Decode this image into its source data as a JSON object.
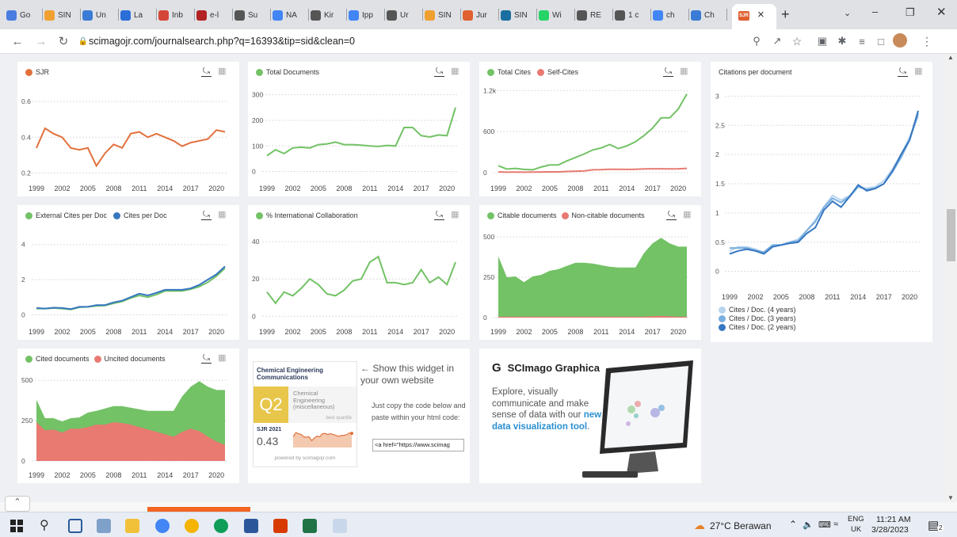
{
  "browser": {
    "tabs": [
      {
        "label": "Go",
        "color": "#4a7de0"
      },
      {
        "label": "SIN",
        "color": "#f0a030"
      },
      {
        "label": "Un",
        "color": "#3a7bd5"
      },
      {
        "label": "La",
        "color": "#2c6ed8"
      },
      {
        "label": "Inb",
        "color": "#d44638"
      },
      {
        "label": "e-l",
        "color": "#b22222"
      },
      {
        "label": "Su",
        "color": "#555"
      },
      {
        "label": "NA",
        "color": "#4285f4"
      },
      {
        "label": "Kir",
        "color": "#555"
      },
      {
        "label": "Ipp",
        "color": "#4285f4"
      },
      {
        "label": "Ur",
        "color": "#555"
      },
      {
        "label": "SIN",
        "color": "#f0a030"
      },
      {
        "label": "Jur",
        "color": "#e06030"
      },
      {
        "label": "SIN",
        "color": "#1a6fa0"
      },
      {
        "label": "Wi",
        "color": "#25d366"
      },
      {
        "label": "RE",
        "color": "#555"
      },
      {
        "label": "1 c",
        "color": "#555"
      },
      {
        "label": "ch",
        "color": "#4285f4"
      },
      {
        "label": "Ch",
        "color": "#3a7bd5"
      }
    ],
    "active_tab_favicon": "SJR",
    "active_close": "×",
    "new_tab": "+",
    "url": "scimagojr.com/journalsearch.php?q=16393&tip=sid&clean=0",
    "nav_icons": [
      "back-icon",
      "forward-icon",
      "reload-icon",
      "lock-icon"
    ]
  },
  "charts": {
    "sjr": {
      "legend": "SJR",
      "color": "#e2713c"
    },
    "total_docs": {
      "legend": "Total Documents",
      "color": "#73c266"
    },
    "total_cites": {
      "legend": "Total Cites",
      "legend2": "Self-Cites",
      "color": "#73c266",
      "color2": "#e87a72"
    },
    "cit_per_doc": {
      "title": "Citations per document",
      "legend": [
        "Cites / Doc. (4 years)",
        "Cites / Doc. (3 years)",
        "Cites / Doc. (2 years)"
      ]
    },
    "ext_cites": {
      "legend": "External Cites per Doc",
      "legend2": "Cites per Doc"
    },
    "intl": {
      "legend": "% International Collaboration"
    },
    "citable": {
      "legend": "Citable documents",
      "legend2": "Non-citable documents"
    },
    "cited": {
      "legend": "Cited documents",
      "legend2": "Uncited documents"
    }
  },
  "widget": {
    "title": "Chemical Engineering Communications",
    "quartile": "Q2",
    "category": "Chemical Engineering (miscellaneous)",
    "best": "best quartile",
    "sjr_label": "SJR 2021",
    "sjr_value": "0.43",
    "powered": "powered by scimagojr.com",
    "show_text": "← Show this widget in your own website",
    "copy_text": "Just copy the code below and paste within your html code:",
    "code": "<a href=\"https://www.scimag"
  },
  "graphica": {
    "title": "SCImago Graphica",
    "text": "Explore, visually communicate and make sense of data with our",
    "link": "new data visualization tool",
    "period": "."
  },
  "taskbar": {
    "weather": "27°C  Berawan",
    "lang": "ENG",
    "region": "UK",
    "time": "11:21 AM",
    "date": "3/28/2023",
    "notif": "2"
  },
  "chart_data": [
    {
      "id": "sjr",
      "type": "line",
      "x": [
        1999,
        2000,
        2001,
        2002,
        2003,
        2004,
        2005,
        2006,
        2007,
        2008,
        2009,
        2010,
        2011,
        2012,
        2013,
        2014,
        2015,
        2016,
        2017,
        2018,
        2019,
        2020,
        2021
      ],
      "series": [
        {
          "name": "SJR",
          "values": [
            0.34,
            0.45,
            0.42,
            0.4,
            0.34,
            0.33,
            0.34,
            0.24,
            0.31,
            0.36,
            0.34,
            0.42,
            0.43,
            0.4,
            0.42,
            0.4,
            0.38,
            0.35,
            0.37,
            0.38,
            0.39,
            0.44,
            0.43
          ]
        }
      ],
      "ylim": [
        0.18,
        0.68
      ],
      "yticks": [
        0.2,
        0.4,
        0.6
      ],
      "xticks": [
        1999,
        2002,
        2005,
        2008,
        2011,
        2014,
        2017,
        2020
      ]
    },
    {
      "id": "docs",
      "type": "line",
      "x": [
        1999,
        2000,
        2001,
        2002,
        2003,
        2004,
        2005,
        2006,
        2007,
        2008,
        2009,
        2010,
        2011,
        2012,
        2013,
        2014,
        2015,
        2016,
        2017,
        2018,
        2019,
        2020,
        2021
      ],
      "series": [
        {
          "name": "Total Documents",
          "values": [
            62,
            85,
            70,
            92,
            95,
            92,
            105,
            108,
            115,
            105,
            105,
            103,
            100,
            98,
            102,
            100,
            172,
            172,
            140,
            135,
            143,
            140,
            250
          ]
        }
      ],
      "ylim": [
        -20,
        330
      ],
      "yticks": [
        0,
        100,
        200,
        300
      ],
      "xticks": [
        1999,
        2002,
        2005,
        2008,
        2011,
        2014,
        2017,
        2020
      ]
    },
    {
      "id": "cites",
      "type": "line",
      "x": [
        1999,
        2000,
        2001,
        2002,
        2003,
        2004,
        2005,
        2006,
        2007,
        2008,
        2009,
        2010,
        2011,
        2012,
        2013,
        2014,
        2015,
        2016,
        2017,
        2018,
        2019,
        2020,
        2021
      ],
      "series": [
        {
          "name": "Total Cites",
          "values": [
            100,
            50,
            60,
            45,
            40,
            80,
            110,
            110,
            170,
            220,
            270,
            330,
            360,
            410,
            350,
            390,
            450,
            540,
            650,
            800,
            800,
            930,
            1150
          ]
        },
        {
          "name": "Self-Cites",
          "values": [
            10,
            5,
            6,
            5,
            6,
            8,
            10,
            10,
            15,
            20,
            22,
            40,
            42,
            48,
            48,
            45,
            48,
            52,
            55,
            55,
            52,
            55,
            60
          ]
        }
      ],
      "ylim": [
        -60,
        1250
      ],
      "yticks": [
        0,
        600,
        1200
      ],
      "yticklabels": [
        "0",
        "600",
        "1.2k"
      ],
      "xticks": [
        1999,
        2002,
        2005,
        2008,
        2011,
        2014,
        2017,
        2020
      ]
    },
    {
      "id": "cpd",
      "type": "line",
      "x": [
        1999,
        2000,
        2001,
        2002,
        2003,
        2004,
        2005,
        2006,
        2007,
        2008,
        2009,
        2010,
        2011,
        2012,
        2013,
        2014,
        2015,
        2016,
        2017,
        2018,
        2019,
        2020,
        2021
      ],
      "series": [
        {
          "name": "Cites / Doc. (4 years)",
          "values": [
            0.35,
            0.42,
            0.42,
            0.38,
            0.32,
            0.45,
            0.45,
            0.5,
            0.55,
            0.7,
            0.88,
            1.1,
            1.3,
            1.22,
            1.3,
            1.45,
            1.42,
            1.45,
            1.55,
            1.75,
            2.0,
            2.3,
            2.65
          ]
        },
        {
          "name": "Cites / Doc. (3 years)",
          "values": [
            0.4,
            0.4,
            0.4,
            0.36,
            0.33,
            0.45,
            0.45,
            0.5,
            0.52,
            0.7,
            0.85,
            1.1,
            1.25,
            1.18,
            1.28,
            1.45,
            1.4,
            1.42,
            1.5,
            1.7,
            1.95,
            2.25,
            2.7
          ]
        },
        {
          "name": "Cites / Doc. (2 years)",
          "values": [
            0.3,
            0.35,
            0.38,
            0.35,
            0.3,
            0.42,
            0.45,
            0.48,
            0.5,
            0.65,
            0.75,
            1.05,
            1.2,
            1.1,
            1.28,
            1.48,
            1.38,
            1.42,
            1.5,
            1.72,
            2.0,
            2.25,
            2.75
          ]
        }
      ],
      "ylim": [
        -0.1,
        3.1
      ],
      "yticks": [
        0,
        0.5,
        1,
        1.5,
        2,
        2.5,
        3
      ],
      "xticks": [
        1999,
        2002,
        2005,
        2008,
        2011,
        2014,
        2017,
        2020
      ]
    },
    {
      "id": "ext",
      "type": "line",
      "x": [
        1999,
        2000,
        2001,
        2002,
        2003,
        2004,
        2005,
        2006,
        2007,
        2008,
        2009,
        2010,
        2011,
        2012,
        2013,
        2014,
        2015,
        2016,
        2017,
        2018,
        2019,
        2020,
        2021
      ],
      "series": [
        {
          "name": "External Cites per Doc",
          "values": [
            0.35,
            0.35,
            0.38,
            0.35,
            0.3,
            0.42,
            0.45,
            0.5,
            0.52,
            0.65,
            0.75,
            0.95,
            1.1,
            1.0,
            1.15,
            1.35,
            1.35,
            1.35,
            1.45,
            1.6,
            1.85,
            2.2,
            2.65
          ]
        },
        {
          "name": "Cites per Doc",
          "values": [
            0.38,
            0.35,
            0.4,
            0.38,
            0.32,
            0.45,
            0.45,
            0.55,
            0.55,
            0.7,
            0.8,
            1.0,
            1.2,
            1.1,
            1.25,
            1.42,
            1.42,
            1.42,
            1.5,
            1.7,
            2.0,
            2.3,
            2.75
          ]
        }
      ],
      "ylim": [
        -0.3,
        4.8
      ],
      "yticks": [
        0,
        2,
        4
      ],
      "xticks": [
        1999,
        2002,
        2005,
        2008,
        2011,
        2014,
        2017,
        2020
      ]
    },
    {
      "id": "intl",
      "type": "line",
      "x": [
        1999,
        2000,
        2001,
        2002,
        2003,
        2004,
        2005,
        2006,
        2007,
        2008,
        2009,
        2010,
        2011,
        2012,
        2013,
        2014,
        2015,
        2016,
        2017,
        2018,
        2019,
        2020,
        2021
      ],
      "series": [
        {
          "name": "% International Collaboration",
          "values": [
            13,
            7,
            13,
            11,
            15,
            20,
            17,
            12,
            11,
            14,
            19,
            20,
            29,
            32,
            18,
            18,
            17,
            18,
            25,
            18,
            21,
            17,
            29
          ]
        }
      ],
      "ylim": [
        -2,
        46
      ],
      "yticks": [
        0,
        20,
        40
      ],
      "xticks": [
        1999,
        2002,
        2005,
        2008,
        2011,
        2014,
        2017,
        2020
      ]
    },
    {
      "id": "citable",
      "type": "area",
      "x": [
        1999,
        2000,
        2001,
        2002,
        2003,
        2004,
        2005,
        2006,
        2007,
        2008,
        2009,
        2010,
        2011,
        2012,
        2013,
        2014,
        2015,
        2016,
        2017,
        2018,
        2019,
        2020,
        2021
      ],
      "series": [
        {
          "name": "Citable documents",
          "values": [
            380,
            250,
            255,
            220,
            255,
            265,
            290,
            300,
            320,
            340,
            340,
            335,
            325,
            315,
            310,
            310,
            310,
            400,
            460,
            495,
            460,
            440,
            440
          ]
        },
        {
          "name": "Non-citable documents",
          "values": [
            5,
            5,
            5,
            5,
            5,
            5,
            5,
            5,
            5,
            5,
            5,
            5,
            5,
            5,
            5,
            5,
            5,
            5,
            8,
            10,
            8,
            5,
            5
          ]
        }
      ],
      "ylim": [
        -15,
        540
      ],
      "yticks": [
        0,
        250,
        500
      ],
      "xticks": [
        1999,
        2002,
        2005,
        2008,
        2011,
        2014,
        2017,
        2020
      ]
    },
    {
      "id": "cited",
      "type": "area",
      "x": [
        1999,
        2000,
        2001,
        2002,
        2003,
        2004,
        2005,
        2006,
        2007,
        2008,
        2009,
        2010,
        2011,
        2012,
        2013,
        2014,
        2015,
        2016,
        2017,
        2018,
        2019,
        2020,
        2021
      ],
      "series": [
        {
          "name": "Cited documents",
          "values": [
            380,
            265,
            265,
            245,
            265,
            270,
            300,
            310,
            325,
            340,
            340,
            330,
            320,
            310,
            310,
            310,
            310,
            400,
            460,
            495,
            460,
            440,
            440
          ]
        },
        {
          "name": "Uncited documents",
          "values": [
            240,
            190,
            195,
            175,
            200,
            200,
            210,
            225,
            225,
            240,
            235,
            225,
            210,
            195,
            180,
            165,
            150,
            180,
            200,
            185,
            150,
            120,
            100
          ]
        }
      ],
      "ylim": [
        -15,
        540
      ],
      "yticks": [
        0,
        250,
        500
      ],
      "xticks": [
        1999,
        2002,
        2005,
        2008,
        2011,
        2014,
        2017,
        2020
      ]
    },
    {
      "id": "widget-spark",
      "type": "line",
      "x": [
        1999,
        2000,
        2001,
        2002,
        2003,
        2004,
        2005,
        2006,
        2007,
        2008,
        2009,
        2010,
        2011,
        2012,
        2013,
        2014,
        2015,
        2016,
        2017,
        2018,
        2019,
        2020,
        2021
      ],
      "series": [
        {
          "name": "SJR",
          "values": [
            0.34,
            0.45,
            0.42,
            0.4,
            0.34,
            0.33,
            0.34,
            0.24,
            0.31,
            0.36,
            0.34,
            0.42,
            0.43,
            0.4,
            0.42,
            0.4,
            0.38,
            0.35,
            0.37,
            0.38,
            0.39,
            0.44,
            0.43
          ]
        }
      ],
      "ylim": [
        0.1,
        0.6
      ]
    }
  ]
}
